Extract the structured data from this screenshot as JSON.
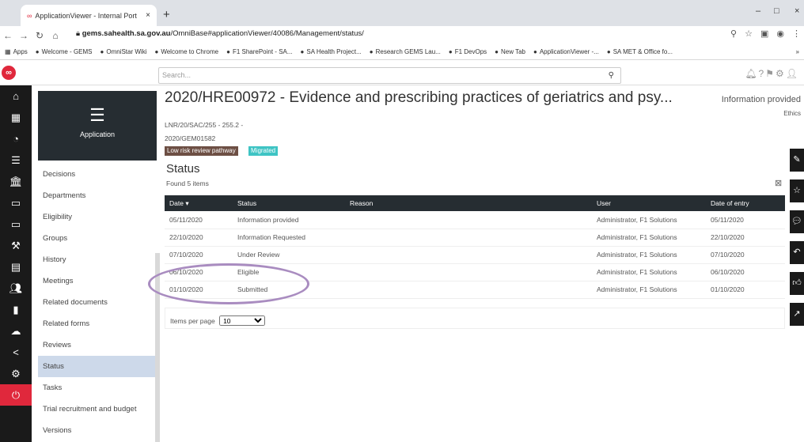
{
  "browser": {
    "tab_title": "ApplicationViewer - Internal Port",
    "tab_close": "×",
    "new_tab": "+",
    "url_host": "gems.sahealth.sa.gov.au",
    "url_path": "/OmniBase#applicationViewer/40086/Management/status/",
    "win_min": "–",
    "win_max": "□",
    "win_close": "×",
    "bookmarks": [
      "Apps",
      "Welcome - GEMS",
      "OmniStar Wiki",
      "Welcome to Chrome",
      "F1 SharePoint - SA...",
      "SA Health Project...",
      "Research GEMS Lau...",
      "F1 DevOps",
      "New Tab",
      "ApplicationViewer -...",
      "SA MET & Office fo..."
    ],
    "bookmarks_more": "»"
  },
  "header": {
    "search_placeholder": "Search...",
    "search_icon": "search-icon"
  },
  "app_box": {
    "label": "Application"
  },
  "submenu": [
    {
      "label": "Decisions"
    },
    {
      "label": "Departments"
    },
    {
      "label": "Eligibility"
    },
    {
      "label": "Groups"
    },
    {
      "label": "History"
    },
    {
      "label": "Meetings"
    },
    {
      "label": "Related documents"
    },
    {
      "label": "Related forms"
    },
    {
      "label": "Reviews"
    },
    {
      "label": "Status",
      "active": true
    },
    {
      "label": "Tasks"
    },
    {
      "label": "Trial recruitment and budget"
    },
    {
      "label": "Versions"
    }
  ],
  "page": {
    "title": "2020/HRE00972 - Evidence and prescribing practices of geriatrics and psy...",
    "meta1": "LNR/20/SAC/255 - 255.2 -",
    "meta2": "2020/GEM01582",
    "badge1": "Low risk review pathway",
    "badge2": "Migrated",
    "info_status": "Information provided",
    "info_sub": "Ethics"
  },
  "status": {
    "heading": "Status",
    "found": "Found 5 items",
    "columns": [
      "Date ▾",
      "Status",
      "Reason",
      "User",
      "Date of entry"
    ],
    "rows": [
      {
        "date": "05/11/2020",
        "status": "Information provided",
        "reason": "",
        "user": "Administrator, F1 Solutions",
        "entry": "05/11/2020"
      },
      {
        "date": "22/10/2020",
        "status": "Information Requested",
        "reason": "",
        "user": "Administrator, F1 Solutions",
        "entry": "22/10/2020"
      },
      {
        "date": "07/10/2020",
        "status": "Under Review",
        "reason": "",
        "user": "Administrator, F1 Solutions",
        "entry": "07/10/2020"
      },
      {
        "date": "06/10/2020",
        "status": "Eligible",
        "reason": "",
        "user": "Administrator, F1 Solutions",
        "entry": "06/10/2020"
      },
      {
        "date": "01/10/2020",
        "status": "Submitted",
        "reason": "",
        "user": "Administrator, F1 Solutions",
        "entry": "01/10/2020"
      }
    ],
    "items_per_page_label": "Items per page",
    "items_per_page_value": "10"
  }
}
